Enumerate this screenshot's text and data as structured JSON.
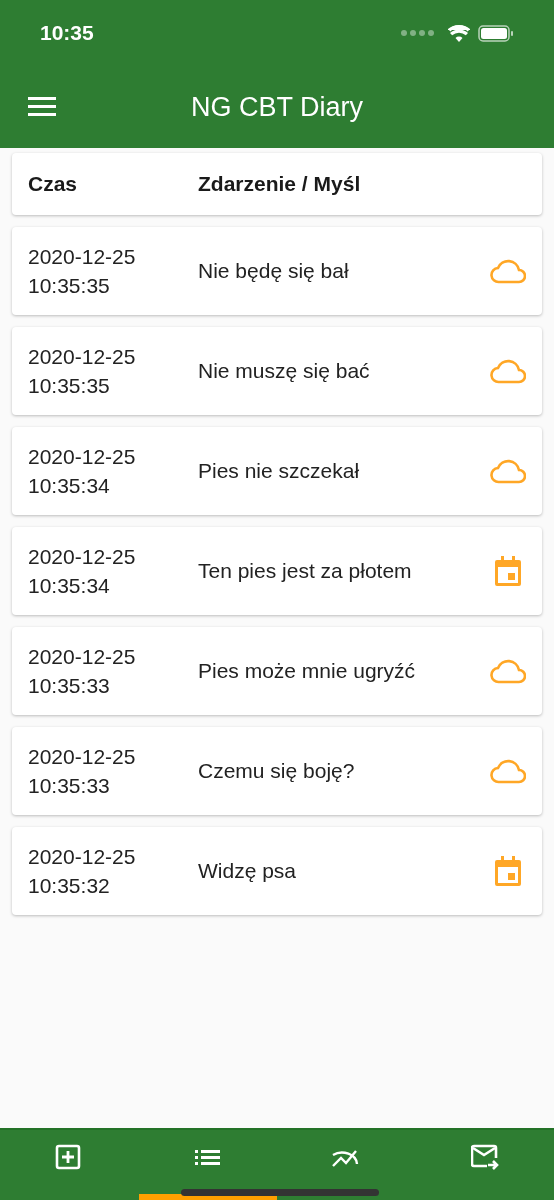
{
  "status_bar": {
    "time": "10:35"
  },
  "app_bar": {
    "title": "NG CBT Diary"
  },
  "table": {
    "columns": [
      "Czas",
      "Zdarzenie / Myśl"
    ],
    "rows": [
      {
        "date": "2020-12-25",
        "time": "10:35:35",
        "text": "Nie będę się bał",
        "kind": "thought"
      },
      {
        "date": "2020-12-25",
        "time": "10:35:35",
        "text": "Nie muszę się bać",
        "kind": "thought"
      },
      {
        "date": "2020-12-25",
        "time": "10:35:34",
        "text": "Pies nie szczekał",
        "kind": "thought"
      },
      {
        "date": "2020-12-25",
        "time": "10:35:34",
        "text": "Ten pies jest za płotem",
        "kind": "event"
      },
      {
        "date": "2020-12-25",
        "time": "10:35:33",
        "text": "Pies może mnie ugryźć",
        "kind": "thought"
      },
      {
        "date": "2020-12-25",
        "time": "10:35:33",
        "text": "Czemu się boję?",
        "kind": "thought"
      },
      {
        "date": "2020-12-25",
        "time": "10:35:32",
        "text": "Widzę psa",
        "kind": "event"
      }
    ]
  },
  "bottom_nav": [
    {
      "kind": "add",
      "selected": false
    },
    {
      "kind": "list",
      "selected": true
    },
    {
      "kind": "chart",
      "selected": false
    },
    {
      "kind": "mail",
      "selected": false
    }
  ]
}
